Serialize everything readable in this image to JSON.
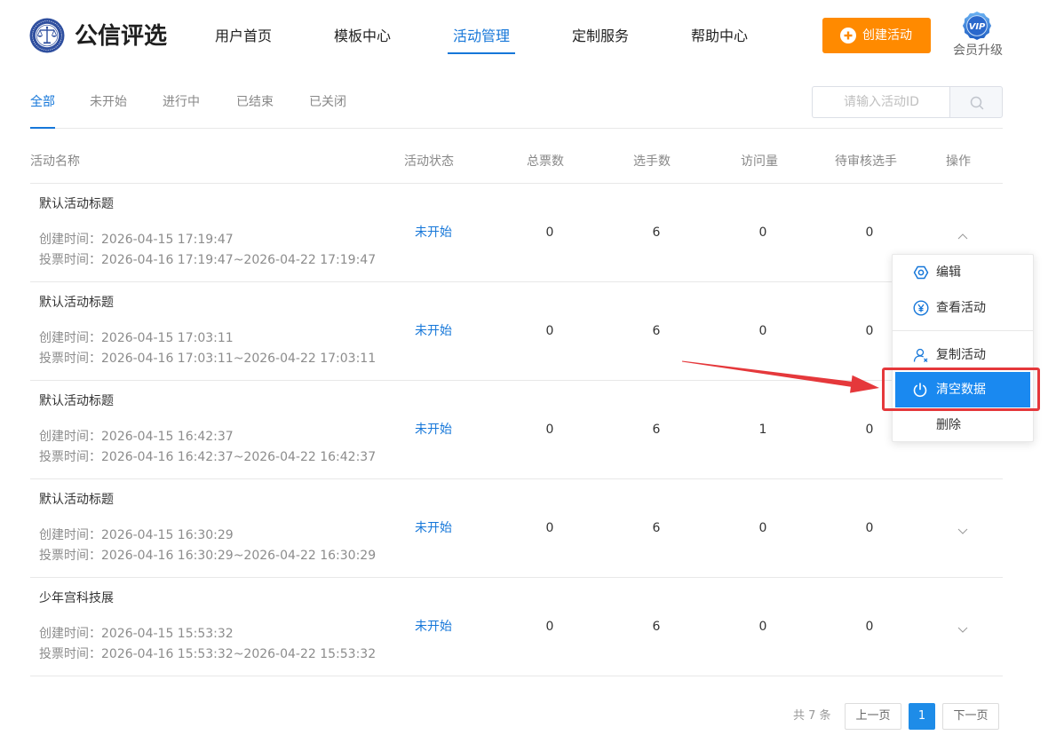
{
  "app": {
    "logo_text": "公信评选"
  },
  "nav": {
    "items": [
      {
        "label": "用户首页"
      },
      {
        "label": "模板中心"
      },
      {
        "label": "活动管理",
        "active": true
      },
      {
        "label": "定制服务"
      },
      {
        "label": "帮助中心"
      }
    ]
  },
  "header": {
    "create_button": {
      "label": "创建活动",
      "icon": "plus-circle-icon"
    },
    "vip": {
      "badge_text": "VIP",
      "label": "会员升级",
      "icon": "vip-badge-icon"
    }
  },
  "tabs": [
    {
      "label": "全部",
      "active": true
    },
    {
      "label": "未开始"
    },
    {
      "label": "进行中"
    },
    {
      "label": "已结束"
    },
    {
      "label": "已关闭"
    }
  ],
  "search": {
    "placeholder": "请输入活动ID",
    "icon": "search-icon"
  },
  "table": {
    "columns": [
      "活动名称",
      "活动状态",
      "总票数",
      "选手数",
      "访问量",
      "待审核选手",
      "操作"
    ],
    "rows": [
      {
        "title": "默认活动标题",
        "created": "创建时间：2026-04-15 17:19:47",
        "voting": "投票时间：2026-04-16 17:19:47~2026-04-22 17:19:47",
        "status": "未开始",
        "total_votes": 0,
        "players": 6,
        "visits": 0,
        "pending_players": 0,
        "actions_expanded": true
      },
      {
        "title": "默认活动标题",
        "created": "创建时间：2026-04-15 17:03:11",
        "voting": "投票时间：2026-04-16 17:03:11~2026-04-22 17:03:11",
        "status": "未开始",
        "total_votes": 0,
        "players": 6,
        "visits": 0,
        "pending_players": 0,
        "actions_expanded": false
      },
      {
        "title": "默认活动标题",
        "created": "创建时间：2026-04-15 16:42:37",
        "voting": "投票时间：2026-04-16 16:42:37~2026-04-22 16:42:37",
        "status": "未开始",
        "total_votes": 0,
        "players": 6,
        "visits": 1,
        "pending_players": 0,
        "actions_expanded": false
      },
      {
        "title": "默认活动标题",
        "created": "创建时间：2026-04-15 16:30:29",
        "voting": "投票时间：2026-04-16 16:30:29~2026-04-22 16:30:29",
        "status": "未开始",
        "total_votes": 0,
        "players": 6,
        "visits": 0,
        "pending_players": 0,
        "actions_expanded": false
      },
      {
        "title": "少年宫科技展",
        "created": "创建时间：2026-04-15 15:53:32",
        "voting": "投票时间：2026-04-16 15:53:32~2026-04-22 15:53:32",
        "status": "未开始",
        "total_votes": 0,
        "players": 6,
        "visits": 0,
        "pending_players": 0,
        "actions_expanded": false
      }
    ]
  },
  "action_menu": {
    "open_for_row": 0,
    "items": [
      {
        "label": "编辑",
        "icon": "hexagon-settings-icon"
      },
      {
        "label": "查看活动",
        "icon": "yen-circle-icon"
      },
      {
        "label": "复制活动",
        "icon": "user-remove-icon"
      },
      {
        "label": "清空数据",
        "icon": "power-icon",
        "highlighted": true
      },
      {
        "label": "删除"
      }
    ]
  },
  "pagination": {
    "total_text": "共 7 条",
    "prev_label": "上一页",
    "current_page": 1,
    "next_label": "下一页"
  },
  "colors": {
    "primary": "#1677d9",
    "accent_orange": "#ff8a00",
    "menu_highlight": "#1a89f0",
    "annotation_red": "#e5383b",
    "page_active": "#1e8ce8"
  }
}
